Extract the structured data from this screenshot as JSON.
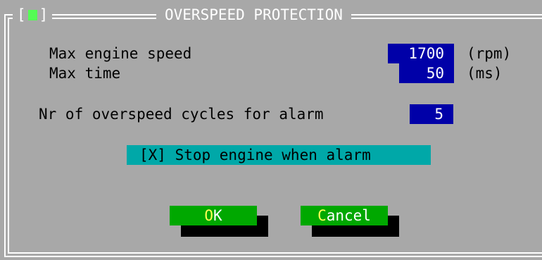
{
  "title": "OVERSPEED PROTECTION",
  "close_box_label": "[",
  "close_box_label_end": "]",
  "fields": {
    "max_engine_speed": {
      "label": "Max engine speed",
      "value": "1700",
      "unit": "(rpm)"
    },
    "max_time": {
      "label": "Max time",
      "value": "50",
      "unit": "(ms)"
    },
    "overspeed_cycles": {
      "label": "Nr of overspeed cycles for alarm",
      "value": "5"
    }
  },
  "stop_engine_checkbox": {
    "label": "[X] Stop engine when alarm",
    "checked": true
  },
  "buttons": {
    "ok": {
      "hotkey": "O",
      "rest": "K"
    },
    "cancel": {
      "hotkey": "C",
      "rest": "ancel"
    }
  },
  "colors": {
    "dialog_bg": "#a8a8a8",
    "field_bg": "#0000a8",
    "checkbox_bg": "#00a8a8",
    "button_bg": "#00a800",
    "hotkey": "#ffff54",
    "close_box": "#54fc54"
  }
}
